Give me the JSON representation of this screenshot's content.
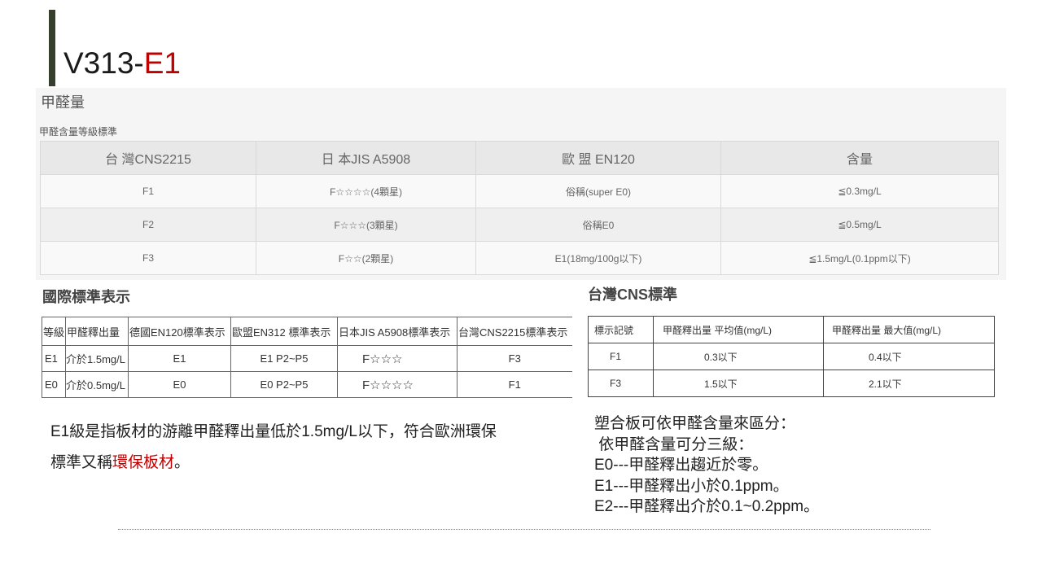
{
  "slide": {
    "title_prefix": "V313-",
    "title_highlight": "E1",
    "accent_bar_color": "#363f2e",
    "highlight_color": "#c00000"
  },
  "formaldehyde_panel": {
    "heading": "甲醛量",
    "subheading": "甲醛含量等級標準",
    "columns": [
      "台 灣CNS2215",
      "日 本JIS A5908",
      "歐 盟 EN120",
      "含量"
    ],
    "rows": [
      [
        "F1",
        "F☆☆☆☆(4顆星)",
        "俗稱(super E0)",
        "≦0.3mg/L"
      ],
      [
        "F2",
        "F☆☆☆(3顆星)",
        "俗稱E0",
        "≦0.5mg/L"
      ],
      [
        "F3",
        "F☆☆(2顆星)",
        "E1(18mg/100g以下)",
        "≦1.5mg/L(0.1ppm以下)"
      ]
    ]
  },
  "international_standards": {
    "heading": "國際標準表示",
    "columns": [
      "等級",
      "甲醛釋出量",
      "德國EN120標準表示",
      "歐盟EN312 標準表示",
      "日本JIS A5908標準表示",
      "台灣CNS2215標準表示"
    ],
    "rows": [
      [
        "E1",
        "介於1.5mg/L",
        "E1",
        "E1 P2~P5",
        "F☆☆☆",
        "F3"
      ],
      [
        "E0",
        "介於0.5mg/L",
        "E0",
        "E0 P2~P5",
        "F☆☆☆☆",
        "F1"
      ]
    ]
  },
  "taiwan_cns": {
    "heading": "台灣CNS標準",
    "columns": [
      "標示記號",
      "甲醛釋出量 平均值(mg/L)",
      "甲醛釋出量 最大值(mg/L)"
    ],
    "rows": [
      [
        "F1",
        "0.3以下",
        "0.4以下"
      ],
      [
        "F3",
        "1.5以下",
        "2.1以下"
      ]
    ]
  },
  "e1_note": {
    "line1": "E1級是指板材的游離甲醛釋出量低於1.5mg/L以下，符合歐洲環保",
    "line2_prefix": "標準又稱",
    "line2_highlight": "環保板材",
    "line2_suffix": "。"
  },
  "particleboard_note": {
    "lines": [
      "塑合板可依甲醛含量來區分：",
      " 依甲醛含量可分三級：",
      "E0---甲醛釋出趨近於零。",
      "E1---甲醛釋出小於0.1ppm。",
      "E2---甲醛釋出介於0.1~0.2ppm。"
    ]
  }
}
